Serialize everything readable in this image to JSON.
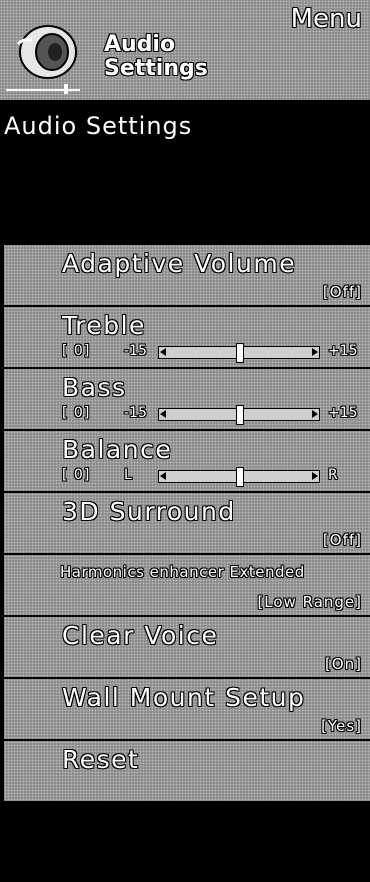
{
  "header": {
    "menu_label": "Menu",
    "title_line1": "Audio",
    "title_line2": "Settings",
    "icon": "speaker-icon"
  },
  "section_title": "Audio Settings",
  "items": [
    {
      "label": "Adaptive Volume",
      "value": "[Off]"
    },
    {
      "label": "Treble",
      "current": "[    0]",
      "min": "-15",
      "max": "+15",
      "level": 0
    },
    {
      "label": "Bass",
      "current": "[    0]",
      "min": "-15",
      "max": "+15",
      "level": 0
    },
    {
      "label": "Balance",
      "current": "[    0]",
      "min": "L",
      "max": "R",
      "level": 0
    },
    {
      "label": "3D Surround",
      "value": "[Off]"
    },
    {
      "label": "Harmonics enhancer Extended",
      "value": "[Low Range]"
    },
    {
      "label": "Clear Voice",
      "value": "[On]"
    },
    {
      "label": "Wall Mount Setup",
      "value": "[Yes]"
    },
    {
      "label": "Reset"
    }
  ]
}
